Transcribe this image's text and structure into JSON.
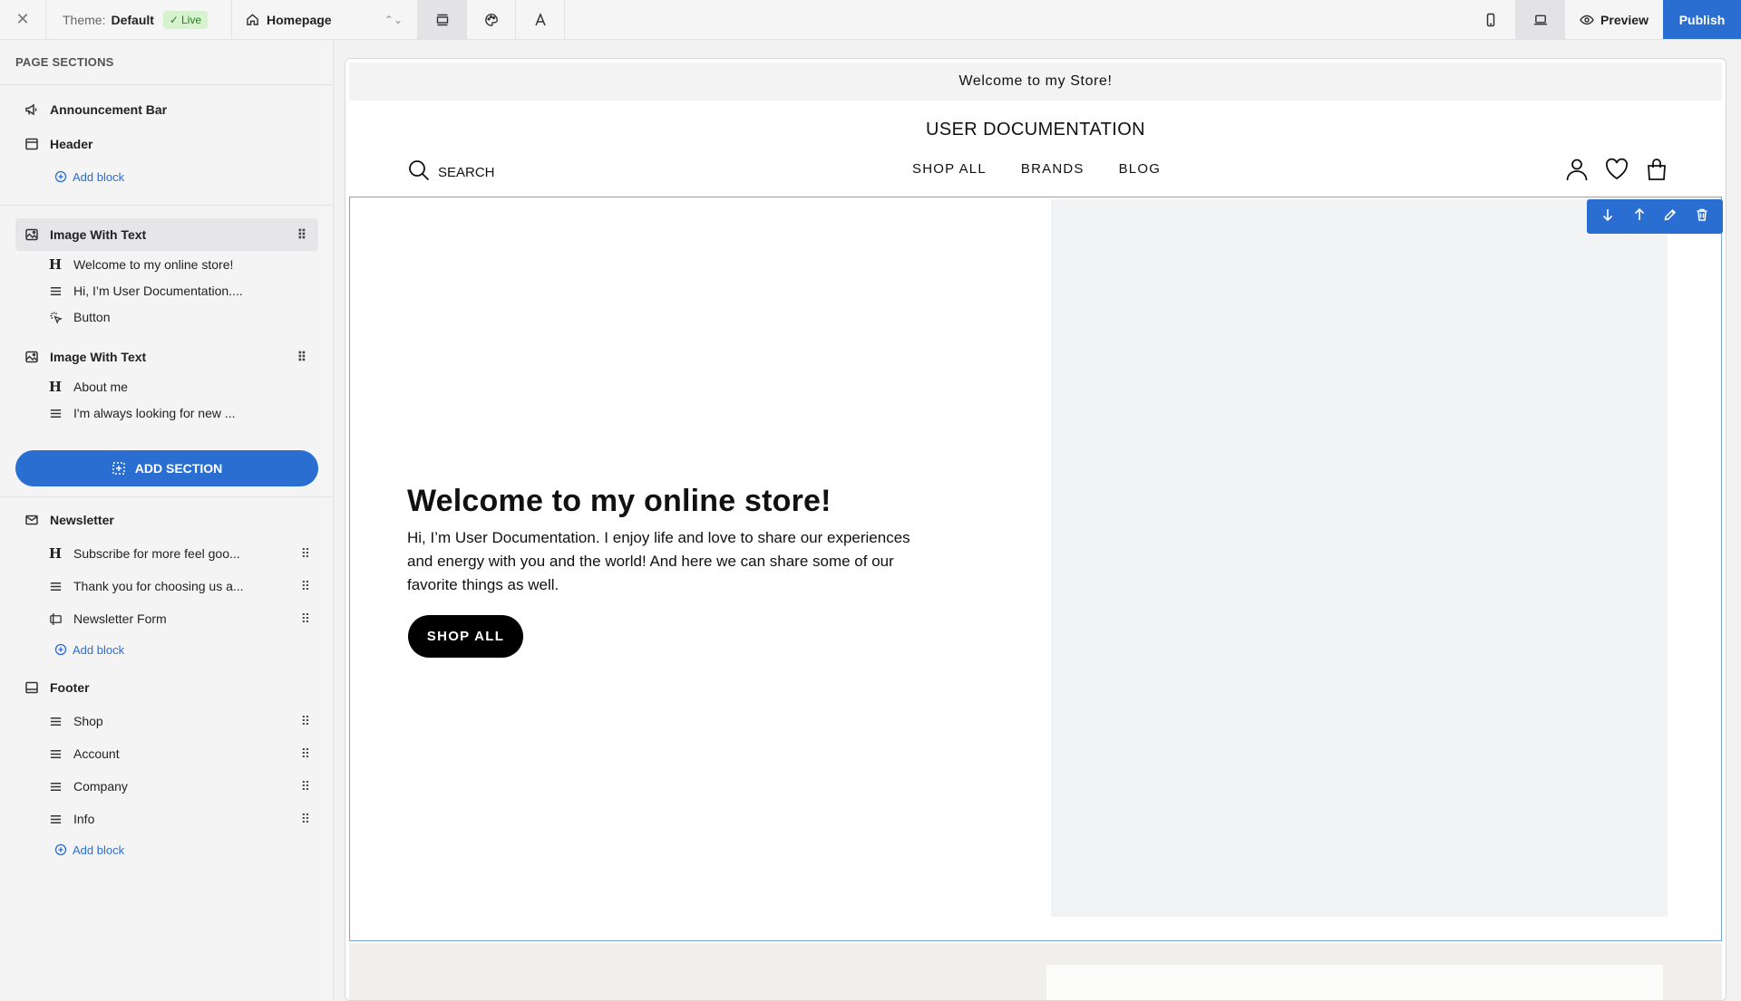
{
  "topbar": {
    "theme_prefix": "Theme:",
    "theme_name": "Default",
    "live_label": "Live",
    "page_name": "Homepage",
    "preview_label": "Preview",
    "publish_label": "Publish"
  },
  "sidebar": {
    "heading": "PAGE SECTIONS",
    "add_block_label": "Add block",
    "add_section_label": "ADD SECTION",
    "announcement_bar": "Announcement Bar",
    "header": "Header",
    "image_with_text_1": {
      "title": "Image With Text",
      "blocks": [
        "Welcome to my online store!",
        "Hi, I’m User Documentation....",
        "Button"
      ]
    },
    "image_with_text_2": {
      "title": "Image With Text",
      "blocks": [
        "About me",
        "I'm always looking for new ..."
      ]
    },
    "newsletter": {
      "title": "Newsletter",
      "blocks": [
        "Subscribe for more feel goo...",
        "Thank you for choosing us a...",
        "Newsletter Form"
      ]
    },
    "footer": {
      "title": "Footer",
      "blocks": [
        "Shop",
        "Account",
        "Company",
        "Info"
      ]
    }
  },
  "preview": {
    "announcement": "Welcome to my Store!",
    "store_title": "USER DOCUMENTATION",
    "search_label": "SEARCH",
    "nav": [
      "SHOP ALL",
      "BRANDS",
      "BLOG"
    ],
    "hero_heading": "Welcome to my online store!",
    "hero_text": "Hi, I’m User Documentation. I enjoy life and love to share our experiences and energy with you and the world! And here we can share some of our favorite things as well.",
    "hero_button": "SHOP ALL"
  },
  "colors": {
    "accent": "#2b6ed2",
    "live_badge_bg": "#d6f2cf",
    "live_badge_text": "#2f7a22"
  }
}
